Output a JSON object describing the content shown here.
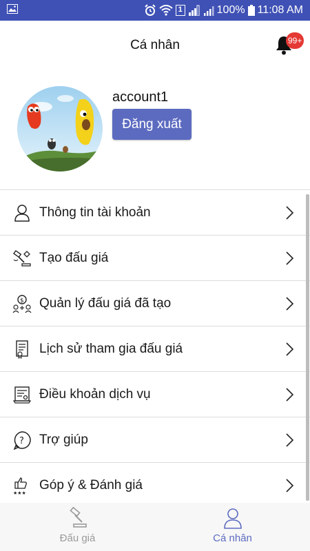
{
  "status_bar": {
    "battery": "100%",
    "time": "11:08 AM",
    "sim_badge": "1"
  },
  "header": {
    "title": "Cá nhân",
    "notification_count": "99+"
  },
  "profile": {
    "username": "account1",
    "logout_label": "Đăng xuất"
  },
  "menu": {
    "items": [
      {
        "label": "Thông tin tài khoản",
        "icon": "user-icon"
      },
      {
        "label": "Tạo đấu giá",
        "icon": "auction-hammer-icon"
      },
      {
        "label": "Quản lý đấu giá đã tạo",
        "icon": "money-management-icon"
      },
      {
        "label": "Lịch sử tham gia đấu giá",
        "icon": "document-history-icon"
      },
      {
        "label": "Điều khoản dịch vụ",
        "icon": "terms-certificate-icon"
      },
      {
        "label": "Trợ giúp",
        "icon": "help-icon"
      },
      {
        "label": "Góp ý & Đánh giá",
        "icon": "feedback-rating-icon"
      }
    ]
  },
  "bottom_nav": {
    "tabs": [
      {
        "label": "Đấu giá",
        "icon": "gavel-icon",
        "active": false
      },
      {
        "label": "Cá nhân",
        "icon": "person-icon",
        "active": true
      }
    ]
  },
  "colors": {
    "primary": "#3f51b5",
    "accent": "#5c6bc0",
    "badge": "#e53935"
  }
}
